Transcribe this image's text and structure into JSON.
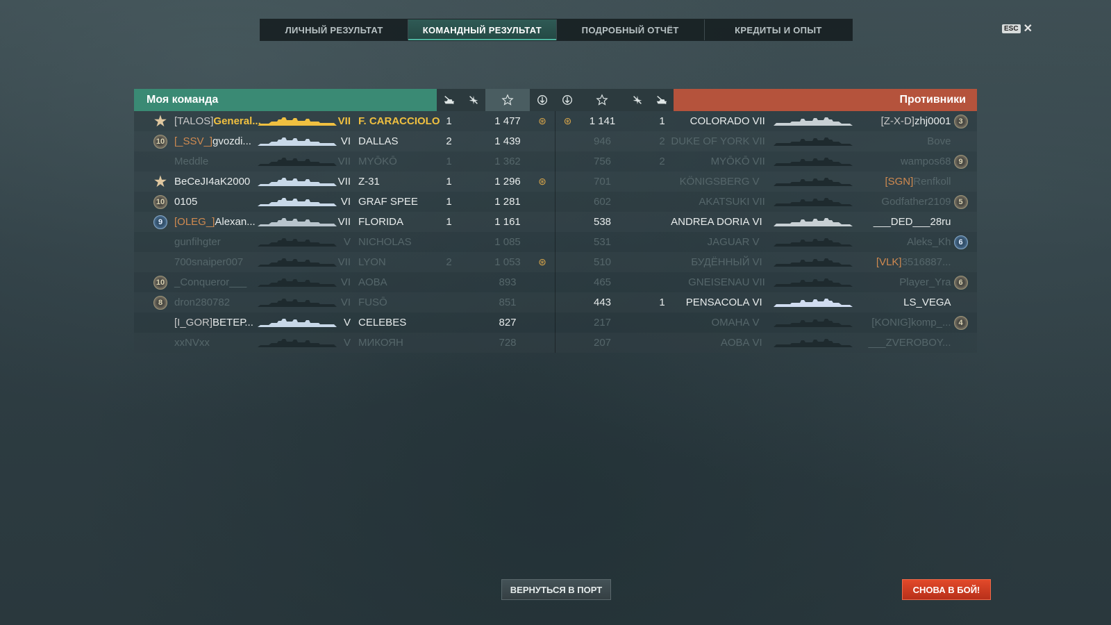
{
  "tabs": [
    {
      "label": "ЛИЧНЫЙ РЕЗУЛЬТАТ",
      "active": false
    },
    {
      "label": "КОМАНДНЫЙ РЕЗУЛЬТАТ",
      "active": true
    },
    {
      "label": "ПОДРОБНЫЙ ОТЧЁТ",
      "active": false
    },
    {
      "label": "КРЕДИТЫ И ОПЫТ",
      "active": false
    }
  ],
  "esc_label": "ESC",
  "my_team": {
    "title": "Моя команда",
    "players": [
      {
        "badge": "star",
        "clan": "[TALOS]",
        "clan_color": "white",
        "name": "General...",
        "tier": "VII",
        "ship": "F. CARACCIOLO",
        "kills": "1",
        "score": "1 477",
        "wreath": true,
        "highlight": true,
        "dim": false,
        "ship_color": "#f0c040"
      },
      {
        "badge": "10",
        "clan": "[_SSV_]",
        "clan_color": "orange",
        "name": "gvozdi...",
        "tier": "VI",
        "ship": "DALLAS",
        "kills": "2",
        "score": "1 439",
        "wreath": false,
        "highlight": false,
        "dim": false,
        "ship_color": "#c8d8e8"
      },
      {
        "badge": "",
        "clan": "",
        "clan_color": "white",
        "name": "Meddle",
        "tier": "VII",
        "ship": "MYŌKŌ",
        "kills": "1",
        "score": "1 362",
        "wreath": false,
        "highlight": false,
        "dim": true,
        "ship_color": "#1e2a2e"
      },
      {
        "badge": "star",
        "clan": "",
        "clan_color": "white",
        "name": "BeCeJI4aK2000",
        "tier": "VII",
        "ship": "Z-31",
        "kills": "1",
        "score": "1 296",
        "wreath": true,
        "highlight": false,
        "dim": false,
        "ship_color": "#c8d8e8"
      },
      {
        "badge": "10",
        "clan": "",
        "clan_color": "white",
        "name": "0105",
        "tier": "VI",
        "ship": "GRAF SPEE",
        "kills": "1",
        "score": "1 281",
        "wreath": false,
        "highlight": false,
        "dim": false,
        "ship_color": "#c8d8e8"
      },
      {
        "badge": "9b",
        "clan": "[OLEG_]",
        "clan_color": "orange",
        "name": "Alexan...",
        "tier": "VII",
        "ship": "FLORIDA",
        "kills": "1",
        "score": "1 161",
        "wreath": false,
        "highlight": false,
        "dim": false,
        "ship_color": "#b8c4cc"
      },
      {
        "badge": "",
        "clan": "",
        "clan_color": "white",
        "name": "gunfihgter",
        "tier": "V",
        "ship": "NICHOLAS",
        "kills": "",
        "score": "1 085",
        "wreath": false,
        "highlight": false,
        "dim": true,
        "ship_color": "#1e2a2e"
      },
      {
        "badge": "",
        "clan": "",
        "clan_color": "white",
        "name": "700snaiper007",
        "tier": "VII",
        "ship": "LYON",
        "kills": "2",
        "score": "1 053",
        "wreath": true,
        "highlight": false,
        "dim": true,
        "ship_color": "#1e2a2e"
      },
      {
        "badge": "10",
        "clan": "",
        "clan_color": "white",
        "name": "_Conqueror___",
        "tier": "VI",
        "ship": "AOBA",
        "kills": "",
        "score": "893",
        "wreath": false,
        "highlight": false,
        "dim": true,
        "ship_color": "#1e2a2e"
      },
      {
        "badge": "8",
        "clan": "",
        "clan_color": "white",
        "name": "dron280782",
        "tier": "VI",
        "ship": "FUSŌ",
        "kills": "",
        "score": "851",
        "wreath": false,
        "highlight": false,
        "dim": true,
        "ship_color": "#1e2a2e"
      },
      {
        "badge": "",
        "clan": "[I_GOR]",
        "clan_color": "white",
        "name": "ВЕТЕР...",
        "tier": "V",
        "ship": "CELEBES",
        "kills": "",
        "score": "827",
        "wreath": false,
        "highlight": false,
        "dim": false,
        "ship_color": "#c8d8e8"
      },
      {
        "badge": "",
        "clan": "",
        "clan_color": "white",
        "name": "xxNVxx",
        "tier": "V",
        "ship": "МИКОЯН",
        "kills": "",
        "score": "728",
        "wreath": false,
        "highlight": false,
        "dim": true,
        "ship_color": "#1e2a2e"
      }
    ]
  },
  "enemy_team": {
    "title": "Противники",
    "players": [
      {
        "wreath": true,
        "score": "1 141",
        "kills": "1",
        "ship": "COLORADO",
        "tier": "VII",
        "clan": "[Z-X-D]",
        "clan_color": "white",
        "name": "zhj0001",
        "badge": "3",
        "dim": false,
        "ship_color": "#c8d0d4"
      },
      {
        "wreath": false,
        "score": "946",
        "kills": "2",
        "ship": "DUKE OF YORK",
        "tier": "VII",
        "clan": "",
        "clan_color": "white",
        "name": "Bove",
        "badge": "",
        "dim": true,
        "ship_color": "#1e2a2e"
      },
      {
        "wreath": false,
        "score": "756",
        "kills": "2",
        "ship": "MYŌKŌ",
        "tier": "VII",
        "clan": "",
        "clan_color": "white",
        "name": "wampos68",
        "badge": "9",
        "dim": true,
        "ship_color": "#1e2a2e"
      },
      {
        "wreath": false,
        "score": "701",
        "kills": "",
        "ship": "KÖNIGSBERG",
        "tier": "V",
        "clan": "[SGN]",
        "clan_color": "orange",
        "name": "Renfkoll",
        "badge": "",
        "dim": true,
        "ship_color": "#1e2a2e"
      },
      {
        "wreath": false,
        "score": "602",
        "kills": "",
        "ship": "AKATSUKI",
        "tier": "VII",
        "clan": "",
        "clan_color": "white",
        "name": "Godfather2109",
        "badge": "5",
        "dim": true,
        "ship_color": "#1e2a2e"
      },
      {
        "wreath": false,
        "score": "538",
        "kills": "",
        "ship": "ANDREA DORIA",
        "tier": "VI",
        "clan": "",
        "clan_color": "white",
        "name": "___DED___28ru",
        "badge": "",
        "dim": false,
        "ship_color": "#c8d0d4"
      },
      {
        "wreath": false,
        "score": "531",
        "kills": "",
        "ship": "JAGUAR",
        "tier": "V",
        "clan": "",
        "clan_color": "white",
        "name": "Aleks_Kh",
        "badge": "6b",
        "dim": true,
        "ship_color": "#1e2a2e"
      },
      {
        "wreath": false,
        "score": "510",
        "kills": "",
        "ship": "БУДЁННЫЙ",
        "tier": "VI",
        "clan": "[VLK]",
        "clan_color": "orange",
        "name": "3516887...",
        "badge": "",
        "dim": true,
        "ship_color": "#1e2a2e"
      },
      {
        "wreath": false,
        "score": "465",
        "kills": "",
        "ship": "GNEISENAU",
        "tier": "VII",
        "clan": "",
        "clan_color": "white",
        "name": "Player_Yra",
        "badge": "6",
        "dim": true,
        "ship_color": "#1e2a2e"
      },
      {
        "wreath": false,
        "score": "443",
        "kills": "1",
        "ship": "PENSACOLA",
        "tier": "VI",
        "clan": "",
        "clan_color": "white",
        "name": "LS_VEGA",
        "badge": "",
        "dim": false,
        "ship_color": "#d0dcf0"
      },
      {
        "wreath": false,
        "score": "217",
        "kills": "",
        "ship": "OMAHA",
        "tier": "V",
        "clan": "[KONIG]",
        "clan_color": "white",
        "name": "komp_...",
        "badge": "4",
        "dim": true,
        "ship_color": "#1e2a2e"
      },
      {
        "wreath": false,
        "score": "207",
        "kills": "",
        "ship": "AOBA",
        "tier": "VI",
        "clan": "",
        "clan_color": "white",
        "name": "___ZVEROBOY...",
        "badge": "",
        "dim": true,
        "ship_color": "#1e2a2e"
      }
    ]
  },
  "buttons": {
    "port": "ВЕРНУТЬСЯ В ПОРТ",
    "battle": "СНОВА В БОЙ!"
  }
}
